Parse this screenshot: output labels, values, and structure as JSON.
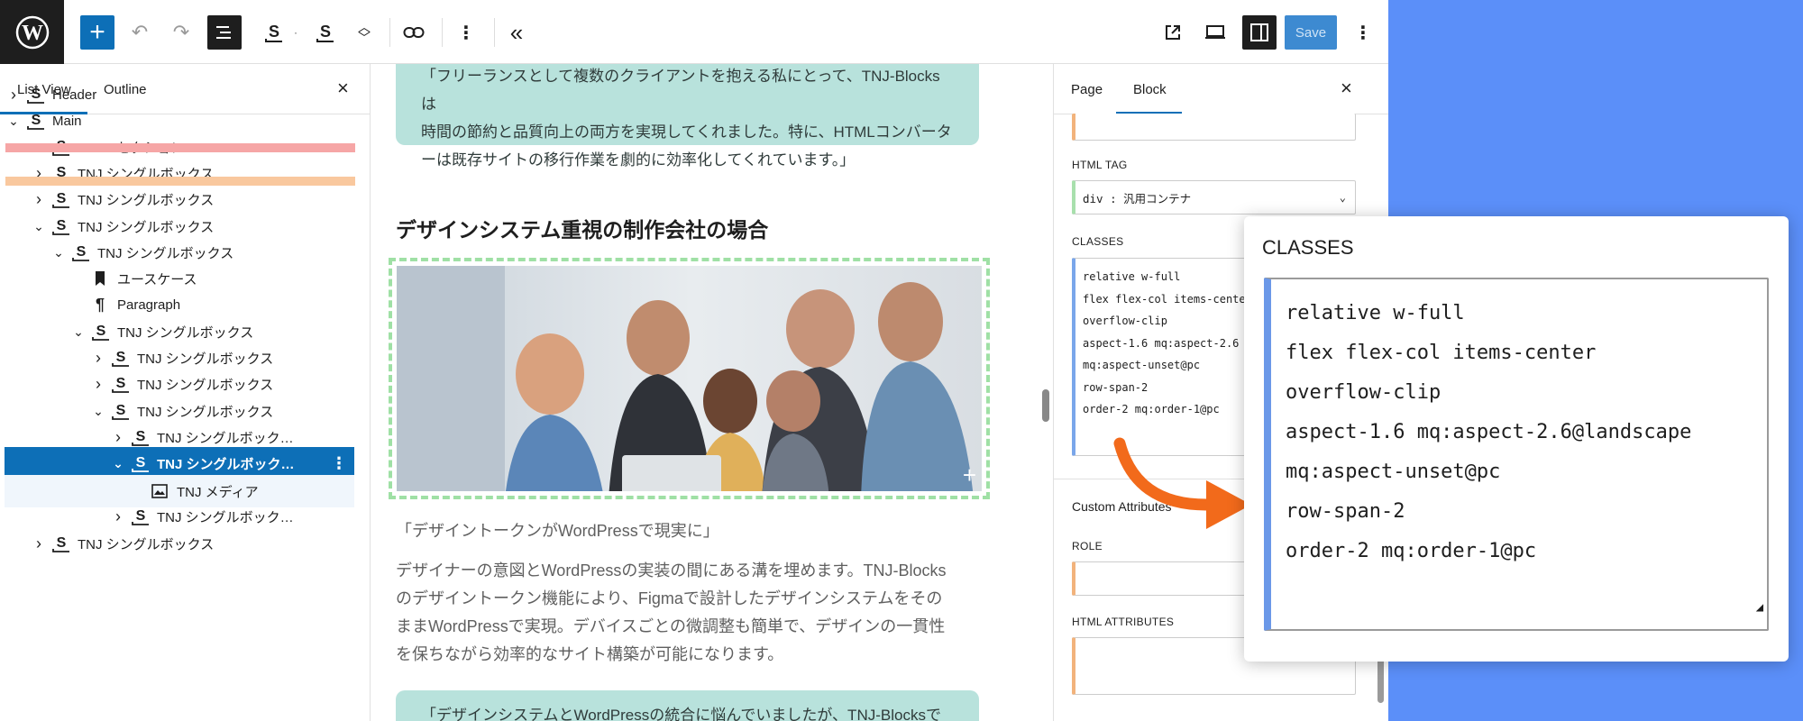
{
  "toolbar": {
    "save_label": "Save",
    "icons": [
      "wordpress-logo",
      "plus-icon",
      "undo-icon",
      "redo-icon",
      "list-view-icon",
      "block-icon",
      "block-icon",
      "move-icon",
      "link-icon",
      "more-vertical-icon",
      "collapse-icon",
      "external-link-icon",
      "desktop-icon",
      "sidebar-icon",
      "more-vertical-icon"
    ]
  },
  "left_panel": {
    "tabs": [
      "List View",
      "Outline"
    ],
    "active_tab": "List View",
    "tree": [
      {
        "label": "Header",
        "expanded": false
      },
      {
        "label": "Main",
        "expanded": true
      },
      {
        "label": "HEROセクション",
        "expanded": false
      },
      {
        "label": "TNJ シングルボックス",
        "expanded": false
      },
      {
        "label": "TNJ シングルボックス",
        "expanded": false
      },
      {
        "label": "TNJ シングルボックス",
        "expanded": true
      },
      {
        "label": "TNJ シングルボックス",
        "expanded": true
      },
      {
        "label": "ユースケース",
        "icon": "bookmark-icon"
      },
      {
        "label": "Paragraph",
        "icon": "paragraph-icon"
      },
      {
        "label": "TNJ シングルボックス",
        "expanded": true
      },
      {
        "label": "TNJ シングルボックス",
        "expanded": false
      },
      {
        "label": "TNJ シングルボックス",
        "expanded": false
      },
      {
        "label": "TNJ シングルボックス",
        "expanded": true
      },
      {
        "label": "TNJ シングルボック…",
        "expanded": false
      },
      {
        "label": "TNJ シングルボック…",
        "expanded": true,
        "selected": true
      },
      {
        "label": "TNJ メディア",
        "icon": "media-icon"
      },
      {
        "label": "TNJ シングルボック…",
        "expanded": false
      },
      {
        "label": "TNJ シングルボックス",
        "expanded": false
      }
    ],
    "highlight_colors": {
      "header": "#f6a6a6",
      "main": "#f9c89e"
    }
  },
  "canvas": {
    "quote_top_lines": [
      "「フリーランスとして複数のクライアントを抱える私にとって、TNJ-Blocksは",
      "時間の節約と品質向上の両方を実現してくれました。特に、HTMLコンバータ",
      "ーは既存サイトの移行作業を劇的に効率化してくれています。」"
    ],
    "heading": "デザインシステム重視の制作会社の場合",
    "caption": "「デザイントークンがWordPressで現実に」",
    "paragraph_lines": [
      "デザイナーの意図とWordPressの実装の間にある溝を埋めます。TNJ-Blocks",
      "のデザイントークン機能により、Figmaで設計したデザインシステムをその",
      "ままWordPressで実現。デバイスごとの微調整も簡単で、デザインの一貫性",
      "を保ちながら効率的なサイト構築が可能になります。"
    ],
    "quote_bottom": "「デザインシステムとWordPressの統合に悩んでいましたが、TNJ-Blocksで解"
  },
  "right_panel": {
    "tabs": [
      "Page",
      "Block"
    ],
    "active_tab": "Block",
    "html_tag_label": "HTML TAG",
    "html_tag_value": "div : 汎用コンテナ",
    "classes_label": "CLASSES",
    "custom_attributes_label": "Custom Attributes",
    "role_label": "ROLE",
    "html_attributes_label": "HTML ATTRIBUTES",
    "classes_small": "relative w-full\nflex flex-col items-center\noverflow-clip\naspect-1.6 mq:aspect-2.6\nmq:aspect-unset@pc\nrow-span-2\norder-2 mq:order-1@pc"
  },
  "zoom_callout": {
    "title": "CLASSES",
    "lines": [
      "relative w-full",
      "flex flex-col items-center",
      "overflow-clip",
      "aspect-1.6 mq:aspect-2.6@landscape",
      "mq:aspect-unset@pc",
      "row-span-2",
      "order-2 mq:order-1@pc"
    ]
  },
  "colors": {
    "accent": "#0d6fb7",
    "quote_bg": "#b8e2dc",
    "arrow": "#f26a1b",
    "background": "#5b8ff9"
  }
}
